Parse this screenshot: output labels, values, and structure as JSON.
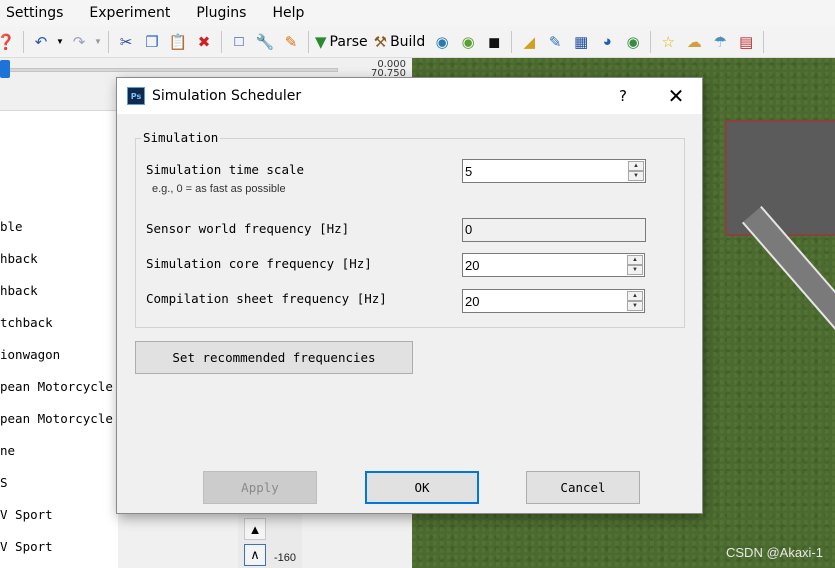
{
  "menubar": {
    "items": [
      "Settings",
      "Experiment",
      "Plugins",
      "Help"
    ]
  },
  "toolbar": {
    "parse_label": "Parse",
    "build_label": "Build",
    "icons": [
      "help-icon",
      "undo-icon",
      "redo-icon",
      "cut-icon",
      "copy-icon",
      "paste-icon",
      "delete-icon",
      "select-icon",
      "wrench-icon",
      "pencil-icon",
      "parse-icon",
      "build-icon",
      "globe-icon",
      "globe2-icon",
      "terminal-icon",
      "ruler-icon",
      "pen-ruler-icon",
      "grid-icon",
      "gauge-icon",
      "earth-icon",
      "star-icon",
      "cloud-icon",
      "weather-icon",
      "chart-icon"
    ]
  },
  "slider": {
    "value_top": "0.000",
    "value_bottom": "70.750"
  },
  "left_list": {
    "items": [
      "ble",
      "hback",
      "hback",
      "tchback",
      "ionwagon",
      "pean Motorcycle",
      "pean Motorcycle w",
      "ne",
      "S",
      "V Sport",
      "V Sport"
    ]
  },
  "map": {
    "watermark": "CSDN @Akaxi-1"
  },
  "bottom_strip": {
    "label": "-160"
  },
  "dialog": {
    "app_icon_text": "Ps",
    "title": "Simulation Scheduler",
    "help_label": "?",
    "close_label": "✕",
    "group_title": "Simulation",
    "time_scale": {
      "label": "Simulation time scale",
      "hint": "e.g., 0 = as fast as possible",
      "value": "5"
    },
    "sensor_freq": {
      "label": "Sensor world frequency [Hz]",
      "value": "0"
    },
    "core_freq": {
      "label": "Simulation core frequency [Hz]",
      "value": "20"
    },
    "sheet_freq": {
      "label": "Compilation sheet frequency [Hz]",
      "value": "20"
    },
    "recommended_label": "Set recommended frequencies",
    "apply_label": "Apply",
    "ok_label": "OK",
    "cancel_label": "Cancel"
  }
}
